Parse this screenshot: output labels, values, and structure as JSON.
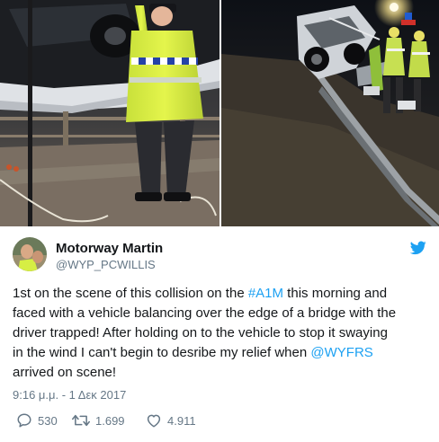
{
  "tweet": {
    "author_name": "Motorway Martin",
    "author_handle": "@WYP_PCWILLIS",
    "text_lines": [
      [
        {
          "t": "1st on the scene of this collision on the "
        },
        {
          "t": "#A1M",
          "link": true
        },
        {
          "t": " this morning and"
        }
      ],
      [
        {
          "t": "faced with a vehicle balancing over the edge of a bridge with the"
        }
      ],
      [
        {
          "t": "driver trapped! After holding on to the vehicle to stop it swaying"
        }
      ],
      [
        {
          "t": "in the wind I can't begin to desribe my relief when "
        },
        {
          "t": "@WYFRS",
          "link": true
        }
      ],
      [
        {
          "t": "arrived on scene!"
        }
      ]
    ],
    "timestamp": "9:16 μ.μ. - 1 Δεκ 2017",
    "stats": {
      "replies": "530",
      "retweets": "1.699",
      "likes": "4.911"
    }
  },
  "icons": {
    "platform": "bird-icon",
    "reply": "reply-icon",
    "retweet": "retweet-icon",
    "like": "heart-icon"
  },
  "colors": {
    "link": "#1da1f2",
    "text": "#14171a",
    "secondary": "#657786",
    "hi_vis": "#d8f23a"
  }
}
